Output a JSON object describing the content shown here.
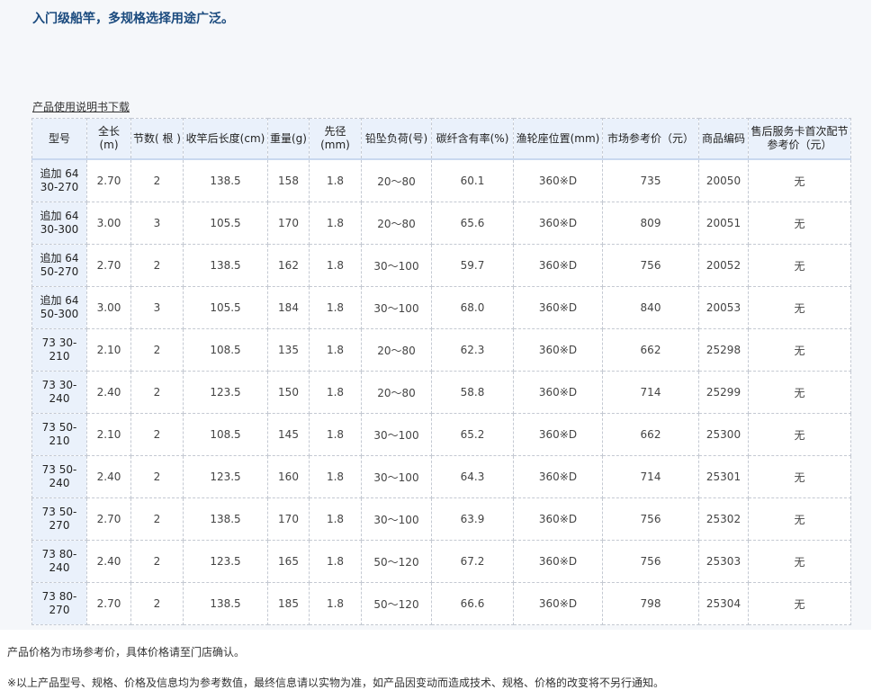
{
  "headline": "入门级船竿，多规格选择用途广泛。",
  "manual_link": "产品使用说明书下载",
  "table": {
    "headers": [
      "型号",
      "全长(m)",
      "节数( 根 )",
      "收竿后长度(cm)",
      "重量(g)",
      "先径(mm)",
      "铅坠负荷(号)",
      "碳纤含有率(%)",
      "渔轮座位置(mm)",
      "市场参考价（元）",
      "商品编码",
      "售后服务卡首次配节参考价（元）"
    ],
    "rows": [
      [
        "追加 64 30-270",
        "2.70",
        "2",
        "138.5",
        "158",
        "1.8",
        "20～80",
        "60.1",
        "360※D",
        "735",
        "20050",
        "无"
      ],
      [
        "追加 64 30-300",
        "3.00",
        "3",
        "105.5",
        "170",
        "1.8",
        "20～80",
        "65.6",
        "360※D",
        "809",
        "20051",
        "无"
      ],
      [
        "追加 64 50-270",
        "2.70",
        "2",
        "138.5",
        "162",
        "1.8",
        "30～100",
        "59.7",
        "360※D",
        "756",
        "20052",
        "无"
      ],
      [
        "追加 64 50-300",
        "3.00",
        "3",
        "105.5",
        "184",
        "1.8",
        "30～100",
        "68.0",
        "360※D",
        "840",
        "20053",
        "无"
      ],
      [
        "73 30-210",
        "2.10",
        "2",
        "108.5",
        "135",
        "1.8",
        "20～80",
        "62.3",
        "360※D",
        "662",
        "25298",
        "无"
      ],
      [
        "73 30-240",
        "2.40",
        "2",
        "123.5",
        "150",
        "1.8",
        "20～80",
        "58.8",
        "360※D",
        "714",
        "25299",
        "无"
      ],
      [
        "73 50-210",
        "2.10",
        "2",
        "108.5",
        "145",
        "1.8",
        "30～100",
        "65.2",
        "360※D",
        "662",
        "25300",
        "无"
      ],
      [
        "73 50-240",
        "2.40",
        "2",
        "123.5",
        "160",
        "1.8",
        "30～100",
        "64.3",
        "360※D",
        "714",
        "25301",
        "无"
      ],
      [
        "73 50-270",
        "2.70",
        "2",
        "138.5",
        "170",
        "1.8",
        "30～100",
        "63.9",
        "360※D",
        "756",
        "25302",
        "无"
      ],
      [
        "73 80-240",
        "2.40",
        "2",
        "123.5",
        "165",
        "1.8",
        "50～120",
        "67.2",
        "360※D",
        "756",
        "25303",
        "无"
      ],
      [
        "73 80-270",
        "2.70",
        "2",
        "138.5",
        "185",
        "1.8",
        "50～120",
        "66.6",
        "360※D",
        "798",
        "25304",
        "无"
      ]
    ]
  },
  "footnotes": [
    "产品价格为市场参考价，具体价格请至门店确认。",
    "※以上产品型号、规格、价格及信息均为参考数值，最终信息请以实物为准，如产品因变动而造成技术、规格、价格的改变将不另行通知。"
  ]
}
